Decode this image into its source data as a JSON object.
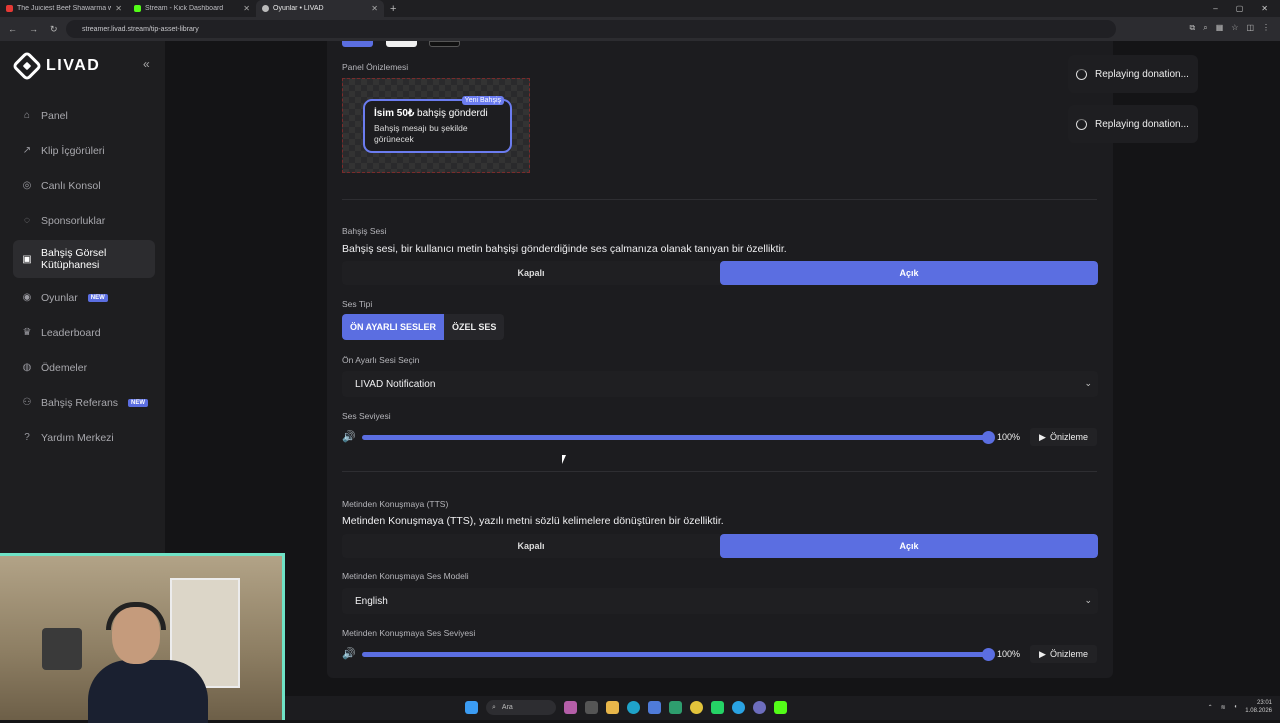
{
  "browser": {
    "tabs": [
      {
        "title": "The Juiciest Beef Shawarma wi",
        "color": "#e53935",
        "active": false
      },
      {
        "title": "Stream - Kick Dashboard",
        "color": "#53fc18",
        "active": false
      },
      {
        "title": "Oyunlar • LIVAD",
        "color": "#bbbbbb",
        "active": true
      }
    ],
    "url": "streamer.livad.stream/tip-asset-library",
    "window_controls": [
      "–",
      "▢",
      "✕"
    ]
  },
  "sidebar": {
    "logo": "LIVAD",
    "collapse_icon": "«",
    "items": [
      {
        "label": "Panel",
        "icon": "home-icon",
        "glyph": "⌂",
        "active": false,
        "badge": ""
      },
      {
        "label": "Klip İçgörüleri",
        "icon": "trend-icon",
        "glyph": "↗",
        "active": false,
        "badge": ""
      },
      {
        "label": "Canlı Konsol",
        "icon": "console-icon",
        "glyph": "◎",
        "active": false,
        "badge": ""
      },
      {
        "label": "Sponsorluklar",
        "icon": "sponsor-icon",
        "glyph": "◌",
        "active": false,
        "badge": ""
      },
      {
        "label": "Bahşiş Görsel Kütüphanesi",
        "icon": "library-icon",
        "glyph": "▣",
        "active": true,
        "badge": ""
      },
      {
        "label": "Oyunlar",
        "icon": "gamepad-icon",
        "glyph": "◉",
        "active": false,
        "badge": "NEW"
      },
      {
        "label": "Leaderboard",
        "icon": "trophy-icon",
        "glyph": "♛",
        "active": false,
        "badge": ""
      },
      {
        "label": "Ödemeler",
        "icon": "payment-icon",
        "glyph": "◍",
        "active": false,
        "badge": ""
      },
      {
        "label": "Bahşiş Referans",
        "icon": "users-icon",
        "glyph": "⚇",
        "active": false,
        "badge": "NEW"
      },
      {
        "label": "Yardım Merkezi",
        "icon": "help-icon",
        "glyph": "?",
        "active": false,
        "badge": ""
      }
    ]
  },
  "preview": {
    "label": "Panel Önizlemesi",
    "badge": "Yeni Bahşiş",
    "title_bold": "İsim 50₺",
    "title_rest": " bahşiş gönderdi",
    "message": "Bahşiş mesajı bu şekilde görünecek"
  },
  "sound": {
    "label": "Bahşiş Sesi",
    "description": "Bahşiş sesi, bir kullanıcı metin bahşişi gönderdiğinde ses çalmanıza olanak tanıyan bir özelliktir.",
    "off_label": "Kapalı",
    "on_label": "Açık",
    "type_label": "Ses Tipi",
    "type_options": [
      "ÖN AYARLI SESLER",
      "ÖZEL SES"
    ],
    "preset_label": "Ön Ayarlı Sesi Seçin",
    "preset_value": "LIVAD Notification",
    "volume_label": "Ses Seviyesi",
    "volume_value": "100%",
    "volume_fraction": 1.0,
    "preview_button": "Önizleme"
  },
  "tts": {
    "label": "Metinden Konuşmaya (TTS)",
    "description": "Metinden Konuşmaya (TTS), yazılı metni sözlü kelimelere dönüştüren bir özelliktir.",
    "off_label": "Kapalı",
    "on_label": "Açık",
    "model_label": "Metinden Konuşmaya Ses Modeli",
    "model_value": "English",
    "volume_label": "Metinden Konuşmaya Ses Seviyesi",
    "volume_value": "100%",
    "volume_fraction": 1.0,
    "preview_button": "Önizleme"
  },
  "notifications": [
    "Replaying donation...",
    "Replaying donation..."
  ],
  "taskbar": {
    "search_placeholder": "Ara",
    "time": "23:01",
    "date": "1.08.2026"
  },
  "colors": {
    "accent": "#5b6ee1",
    "background": "#141416",
    "card": "#1c1c1f"
  }
}
